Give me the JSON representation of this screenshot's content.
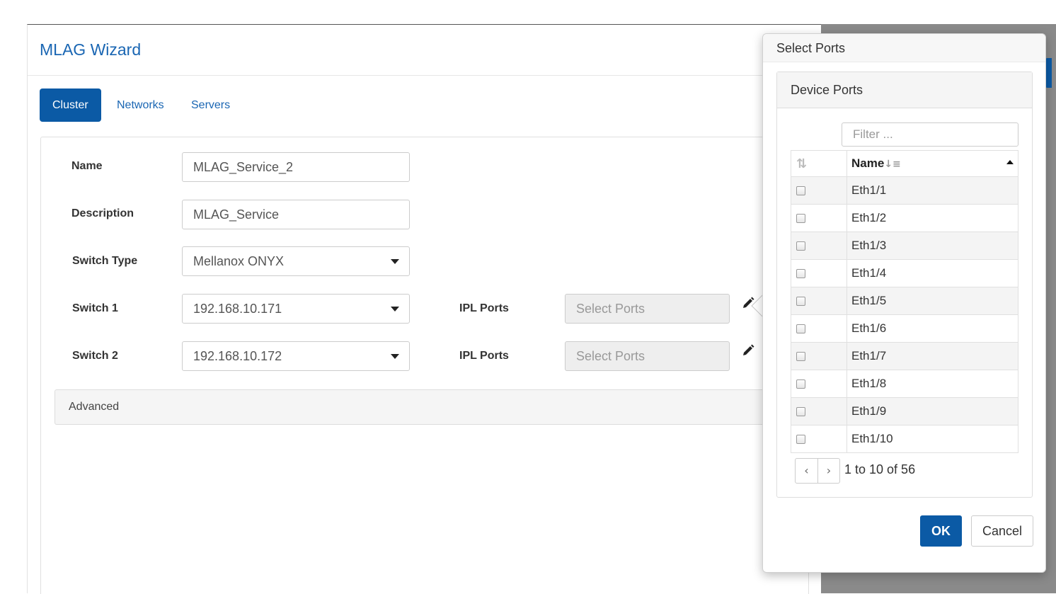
{
  "wizard": {
    "title": "MLAG Wizard",
    "tabs": [
      {
        "label": "Cluster",
        "active": true
      },
      {
        "label": "Networks",
        "active": false
      },
      {
        "label": "Servers",
        "active": false
      }
    ],
    "form": {
      "name_label": "Name",
      "name_value": "MLAG_Service_2",
      "description_label": "Description",
      "description_value": "MLAG_Service",
      "switch_type_label": "Switch Type",
      "switch_type_value": "Mellanox ONYX",
      "switch1_label": "Switch 1",
      "switch1_value": "192.168.10.171",
      "switch2_label": "Switch 2",
      "switch2_value": "192.168.10.172",
      "ipl1_label": "IPL Ports",
      "ipl1_placeholder": "Select Ports",
      "ipl2_label": "IPL Ports",
      "ipl2_placeholder": "Select Ports"
    },
    "advanced_label": "Advanced"
  },
  "popover": {
    "title": "Select Ports",
    "panel_title": "Device Ports",
    "filter_placeholder": "Filter ...",
    "column_name": "Name",
    "ports": [
      "Eth1/1",
      "Eth1/2",
      "Eth1/3",
      "Eth1/4",
      "Eth1/5",
      "Eth1/6",
      "Eth1/7",
      "Eth1/8",
      "Eth1/9",
      "Eth1/10"
    ],
    "pager_text": "1 to 10 of 56",
    "ok_label": "OK",
    "cancel_label": "Cancel"
  },
  "colors": {
    "accent": "#0b5aa5",
    "title_blue": "#1a66b3"
  }
}
